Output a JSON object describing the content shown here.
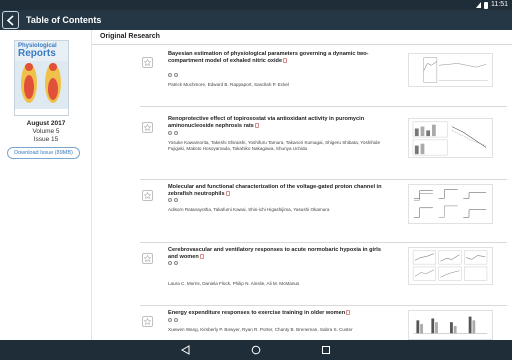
{
  "status": {
    "time": "11:51"
  },
  "appbar": {
    "title": "Table of Contents"
  },
  "issue": {
    "cover_brand_top": "Physiological",
    "cover_brand_bottom": "Reports",
    "date": "August 2017",
    "volume": "Volume 5",
    "issue": "Issue 15",
    "download_label": "Download Issue (89MB)"
  },
  "main": {
    "section": "Original Research",
    "articles": [
      {
        "title": "Bayesian estimation of physiological parameters governing a dynamic two-compartment model of exhaled nitric oxide",
        "authors": "Patrick Muchmore, Edward B. Rappaport, Sandrah P. Eckel"
      },
      {
        "title": "Renoprotective effect of topiroxostat via antioxidant activity in puromycin aminonucleoside nephrosis rats",
        "authors": "Yosuke Kawamorita, Takeshi Shiraishi, Yoshifuru Tamura, Takanori Kumagai, Shigeru Shibata, Yoshihide Fujigaki, Makoto Hosoyamada, Takahiko Nakagawa, Shunya Uchida"
      },
      {
        "title": "Molecular and functional characterization of the voltage-gated proton channel in zebrafish neutrophils",
        "authors": "Adisorn Ratanayotha, Takafumi Kawai, Shin-ichi Higashijima, Yasushi Okamura"
      },
      {
        "title": "Cerebrovascular and ventilatory responses to acute normobaric hypoxia in girls and women",
        "authors": "Laura C. Morris, Daniela Flück, Philip N. Ainslie, Ali M. McManus"
      },
      {
        "title": "Energy expenditure responses to exercise training in older women",
        "authors": "Xuewen Wang, Kimberly P. Bowyer, Ryan R. Porter, Chanty B. Breneman, Sabra S. Custer"
      }
    ]
  },
  "colors": {
    "appbar": "#253644",
    "statusbar": "#1f2d39",
    "accent": "#3a7bbf"
  }
}
